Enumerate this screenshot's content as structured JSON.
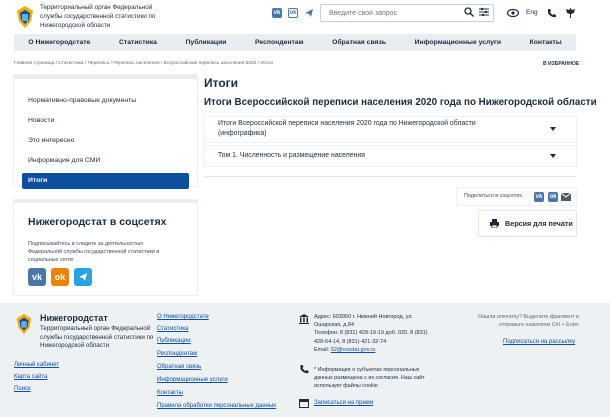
{
  "header": {
    "org_name": "Территориальный орган Федеральной службы государственной статистики по Нижегородской области",
    "search_placeholder": "Введите свой запрос",
    "lang": "Eng"
  },
  "nav": [
    "О Нижегородстате",
    "Статистика",
    "Публикации",
    "Респондентам",
    "Обратная связь",
    "Информационные услуги",
    "Контакты"
  ],
  "breadcrumb": "Главная страница / Статистика / Перепись / Перепись населения / Всероссийская перепись населения 2020 / Итоги",
  "favorites": "В ИЗБРАННОЕ",
  "sidebar": {
    "items": [
      "Нормативно-правовые документы",
      "Новости",
      "Это интересно",
      "Информация для СМИ"
    ],
    "active": "Итоги"
  },
  "social": {
    "title": "Нижегородстат в соцсетях",
    "text": "Подписывайтесь и следите за деятельностью Федеральной службы государственной статистики в социальных сетях"
  },
  "main": {
    "title": "Итоги",
    "subtitle": "Итоги Всероссийской переписи населения 2020 года по Нижегородской области",
    "accordion": [
      "Итоги Всероссийской переписи населения 2020 года по Нижегородской области (инфографика)",
      "Том 1. Численность и размещение населения"
    ],
    "share_label": "Поделиться в соцсетях",
    "print_label": "Версия для печати"
  },
  "footer": {
    "brand": "Нижегородстат",
    "org": "Территориальный орган Федеральной службы государственной статистики по Нижегородской области",
    "left_links": [
      "Личный кабинет",
      "Карта сайта",
      "Поиск"
    ],
    "mid_links": [
      "О Нижегородстате",
      "Статистика",
      "Публикации",
      "Респондентам",
      "Обратная связь",
      "Информационные услуги",
      "Контакты",
      "Правила обработки персональных данных"
    ],
    "address": "Адрес: 603950 г. Нижний Новгород, ул. Ошарская, д.84",
    "phones": "Телефон: 8 (831) 428-19-19 доб. 020, 8 (831) 428-64-14, 8 (831) 421-32-74",
    "email_label": "Email:",
    "email": "52@rosstat.gov.ru",
    "note": "* Информация о субъектах персональных данных размещена с их согласия. Наш сайт использует файлы cookie",
    "appointment": "Записаться на прием",
    "typo": "Нашли опечатку? Выделите фрагмент и отправьте нажатием Ctrl + Enter",
    "subscribe": "Подписаться на рассылку"
  },
  "colors": {
    "accent": "#0b4fa0",
    "vk": "#4a76a8",
    "ok": "#ee8208",
    "tg": "#2aa3de"
  }
}
